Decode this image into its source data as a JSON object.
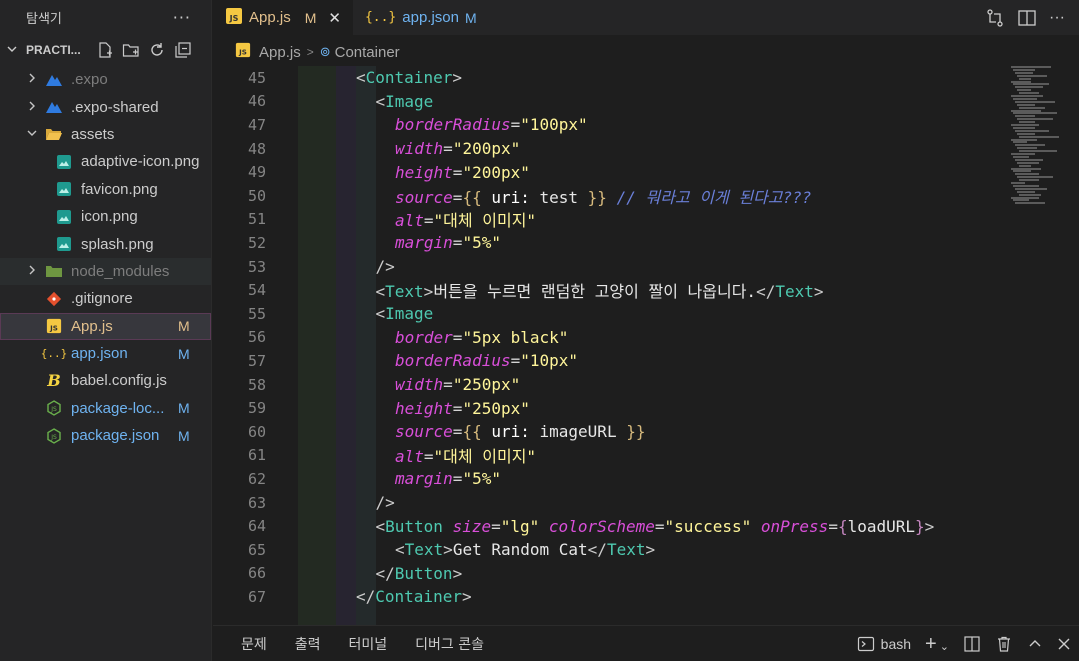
{
  "explorer": {
    "title": "탐색기",
    "more": "···",
    "project_name": "PRACTI...",
    "items": [
      {
        "label": ".expo",
        "type": "folder",
        "icon": "expo-folder-icon",
        "color": "#7d7d7d"
      },
      {
        "label": ".expo-shared",
        "type": "folder",
        "icon": "expo-folder-icon",
        "color": "#cccccc"
      },
      {
        "label": "assets",
        "type": "folder-open",
        "icon": "folder-open-icon",
        "color": "#cccccc"
      },
      {
        "label": "adaptive-icon.png",
        "type": "file",
        "icon": "image-icon",
        "color": "#cccccc"
      },
      {
        "label": "favicon.png",
        "type": "file",
        "icon": "image-icon",
        "color": "#cccccc"
      },
      {
        "label": "icon.png",
        "type": "file",
        "icon": "image-icon",
        "color": "#cccccc"
      },
      {
        "label": "splash.png",
        "type": "file",
        "icon": "image-icon",
        "color": "#cccccc"
      },
      {
        "label": "node_modules",
        "type": "folder",
        "icon": "node-folder-icon",
        "color": "#7d7d7d"
      },
      {
        "label": ".gitignore",
        "type": "file",
        "icon": "git-icon",
        "color": "#cccccc"
      },
      {
        "label": "App.js",
        "type": "file",
        "icon": "js-icon",
        "color": "#e2c08d",
        "badge": "M"
      },
      {
        "label": "app.json",
        "type": "file",
        "icon": "json-icon",
        "color": "#6fb3f0",
        "badge": "M"
      },
      {
        "label": "babel.config.js",
        "type": "file",
        "icon": "babel-icon",
        "color": "#cccccc"
      },
      {
        "label": "package-loc...",
        "type": "file",
        "icon": "nodejs-icon",
        "color": "#6fb3f0",
        "badge": "M"
      },
      {
        "label": "package.json",
        "type": "file",
        "icon": "nodejs-icon",
        "color": "#6fb3f0",
        "badge": "M"
      }
    ]
  },
  "tabs": [
    {
      "label": "App.js",
      "modified": "M",
      "close": "✕",
      "active": true
    },
    {
      "label": "app.json",
      "modified": "M",
      "active": false
    }
  ],
  "breadcrumb": {
    "file": "App.js",
    "symbol": "Container"
  },
  "code_lines": [
    {
      "num": "45",
      "indent": 0,
      "tokens": [
        [
          "p",
          "<"
        ],
        [
          "tag",
          "Container"
        ],
        [
          "p",
          ">"
        ]
      ]
    },
    {
      "num": "46",
      "indent": 1,
      "tokens": [
        [
          "p",
          "<"
        ],
        [
          "tag",
          "Image"
        ]
      ]
    },
    {
      "num": "47",
      "indent": 2,
      "tokens": [
        [
          "attr",
          "borderRadius"
        ],
        [
          "eq",
          "="
        ],
        [
          "str",
          "\"100px\""
        ]
      ]
    },
    {
      "num": "48",
      "indent": 2,
      "tokens": [
        [
          "attr",
          "width"
        ],
        [
          "eq",
          "="
        ],
        [
          "str",
          "\"200px\""
        ]
      ]
    },
    {
      "num": "49",
      "indent": 2,
      "tokens": [
        [
          "attr",
          "height"
        ],
        [
          "eq",
          "="
        ],
        [
          "str",
          "\"200px\""
        ]
      ]
    },
    {
      "num": "50",
      "indent": 2,
      "tokens": [
        [
          "attr",
          "source"
        ],
        [
          "eq",
          "="
        ],
        [
          "br",
          "{{ "
        ],
        [
          "key",
          "uri:"
        ],
        [
          "var",
          " test "
        ],
        [
          "br",
          "}}"
        ],
        [
          "cmt",
          " // 뭐라고 이게 된다고???"
        ]
      ]
    },
    {
      "num": "51",
      "indent": 2,
      "tokens": [
        [
          "attr",
          "alt"
        ],
        [
          "eq",
          "="
        ],
        [
          "str",
          "\"대체 이미지\""
        ]
      ]
    },
    {
      "num": "52",
      "indent": 2,
      "tokens": [
        [
          "attr",
          "margin"
        ],
        [
          "eq",
          "="
        ],
        [
          "str",
          "\"5%\""
        ]
      ]
    },
    {
      "num": "53",
      "indent": 1,
      "tokens": [
        [
          "p",
          "/>"
        ]
      ]
    },
    {
      "num": "54",
      "indent": 1,
      "tokens": [
        [
          "p",
          "<"
        ],
        [
          "tag",
          "Text"
        ],
        [
          "p",
          ">"
        ],
        [
          "txt",
          "버튼을 누르면 랜덤한 고양이 짤이 나옵니다."
        ],
        [
          "p",
          "</"
        ],
        [
          "tag",
          "Text"
        ],
        [
          "p",
          ">"
        ]
      ]
    },
    {
      "num": "55",
      "indent": 1,
      "tokens": [
        [
          "p",
          "<"
        ],
        [
          "tag",
          "Image"
        ]
      ]
    },
    {
      "num": "56",
      "indent": 2,
      "tokens": [
        [
          "attr",
          "border"
        ],
        [
          "eq",
          "="
        ],
        [
          "str",
          "\"5px black\""
        ]
      ]
    },
    {
      "num": "57",
      "indent": 2,
      "tokens": [
        [
          "attr",
          "borderRadius"
        ],
        [
          "eq",
          "="
        ],
        [
          "str",
          "\"10px\""
        ]
      ]
    },
    {
      "num": "58",
      "indent": 2,
      "tokens": [
        [
          "attr",
          "width"
        ],
        [
          "eq",
          "="
        ],
        [
          "str",
          "\"250px\""
        ]
      ]
    },
    {
      "num": "59",
      "indent": 2,
      "tokens": [
        [
          "attr",
          "height"
        ],
        [
          "eq",
          "="
        ],
        [
          "str",
          "\"250px\""
        ]
      ]
    },
    {
      "num": "60",
      "indent": 2,
      "tokens": [
        [
          "attr",
          "source"
        ],
        [
          "eq",
          "="
        ],
        [
          "br",
          "{{ "
        ],
        [
          "key",
          "uri:"
        ],
        [
          "var",
          " imageURL "
        ],
        [
          "br",
          "}}"
        ]
      ]
    },
    {
      "num": "61",
      "indent": 2,
      "tokens": [
        [
          "attr",
          "alt"
        ],
        [
          "eq",
          "="
        ],
        [
          "str",
          "\"대체 이미지\""
        ]
      ]
    },
    {
      "num": "62",
      "indent": 2,
      "tokens": [
        [
          "attr",
          "margin"
        ],
        [
          "eq",
          "="
        ],
        [
          "str",
          "\"5%\""
        ]
      ]
    },
    {
      "num": "63",
      "indent": 1,
      "tokens": [
        [
          "p",
          "/>"
        ]
      ]
    },
    {
      "num": "64",
      "indent": 1,
      "tokens": [
        [
          "p",
          "<"
        ],
        [
          "tag",
          "Button"
        ],
        [
          "p",
          " "
        ],
        [
          "attr",
          "size"
        ],
        [
          "eq",
          "="
        ],
        [
          "str",
          "\"lg\""
        ],
        [
          "p",
          " "
        ],
        [
          "attr",
          "colorScheme"
        ],
        [
          "eq",
          "="
        ],
        [
          "str",
          "\"success\""
        ],
        [
          "p",
          " "
        ],
        [
          "attr",
          "onPress"
        ],
        [
          "eq",
          "="
        ],
        [
          "br2",
          "{"
        ],
        [
          "var",
          "loadURL"
        ],
        [
          "br2",
          "}"
        ],
        [
          "p",
          ">"
        ]
      ]
    },
    {
      "num": "65",
      "indent": 2,
      "tokens": [
        [
          "p",
          "<"
        ],
        [
          "tag",
          "Text"
        ],
        [
          "p",
          ">"
        ],
        [
          "txt",
          "Get Random Cat"
        ],
        [
          "p",
          "</"
        ],
        [
          "tag",
          "Text"
        ],
        [
          "p",
          ">"
        ]
      ]
    },
    {
      "num": "66",
      "indent": 1,
      "tokens": [
        [
          "p",
          "</"
        ],
        [
          "tag",
          "Button"
        ],
        [
          "p",
          ">"
        ]
      ]
    },
    {
      "num": "67",
      "indent": 0,
      "tokens": [
        [
          "p",
          "</"
        ],
        [
          "tag",
          "Container"
        ],
        [
          "p",
          ">"
        ]
      ]
    }
  ],
  "panel": {
    "tabs": [
      "문제",
      "출력",
      "터미널",
      "디버그 콘솔"
    ],
    "terminal_name": "bash"
  }
}
